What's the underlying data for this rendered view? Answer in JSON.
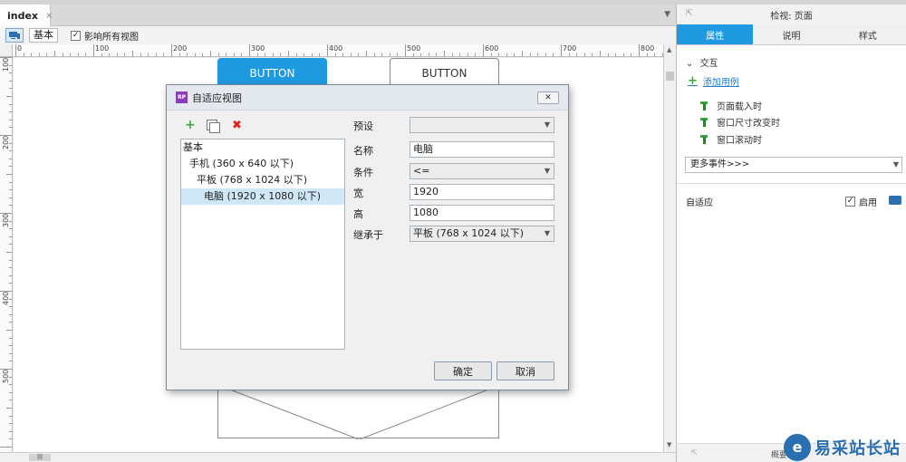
{
  "doc_tab": {
    "label": "index",
    "close": "×"
  },
  "toolbar": {
    "basic_label": "基本",
    "affect_all_label": "影响所有视图",
    "affect_all_checked": true
  },
  "rulers": {
    "h_labels": [
      "0",
      "100",
      "200",
      "300",
      "400",
      "500",
      "600",
      "700",
      "800"
    ],
    "v_labels": [
      "100",
      "200",
      "300",
      "400",
      "500"
    ]
  },
  "canvas": {
    "button_primary": "BUTTON",
    "button_secondary": "BUTTON"
  },
  "right_panel": {
    "title": "检视: 页面",
    "tabs": [
      "属性",
      "说明",
      "样式"
    ],
    "active_tab": "属性",
    "section": "交互",
    "add_case": "添加用例",
    "events": [
      "页面载入时",
      "窗口尺寸改变时",
      "窗口滚动时"
    ],
    "more_events": "更多事件>>>",
    "adaptive_label": "自适应",
    "enable_label": "启用",
    "enable_checked": true,
    "bottom_label": "概要"
  },
  "dialog": {
    "title": "自适应视图",
    "tree": [
      "基本",
      "手机 (360 x 640 以下)",
      "平板 (768 x 1024 以下)",
      "电脑 (1920 x 1080 以下)"
    ],
    "selected_index": 3,
    "labels": {
      "preset": "预设",
      "name": "名称",
      "condition": "条件",
      "width": "宽",
      "height": "高",
      "inherit": "继承于"
    },
    "values": {
      "preset": "",
      "name": "电脑",
      "condition": "<=",
      "width": "1920",
      "height": "1080",
      "inherit": "平板 (768 x 1024 以下)"
    },
    "ok": "确定",
    "cancel": "取消"
  },
  "watermark": {
    "text": "易采站长站"
  },
  "colors": {
    "accent": "#1f9ae0",
    "green": "#3aa83a",
    "red": "#e02020",
    "rp_logo": "#8a3fb6"
  }
}
